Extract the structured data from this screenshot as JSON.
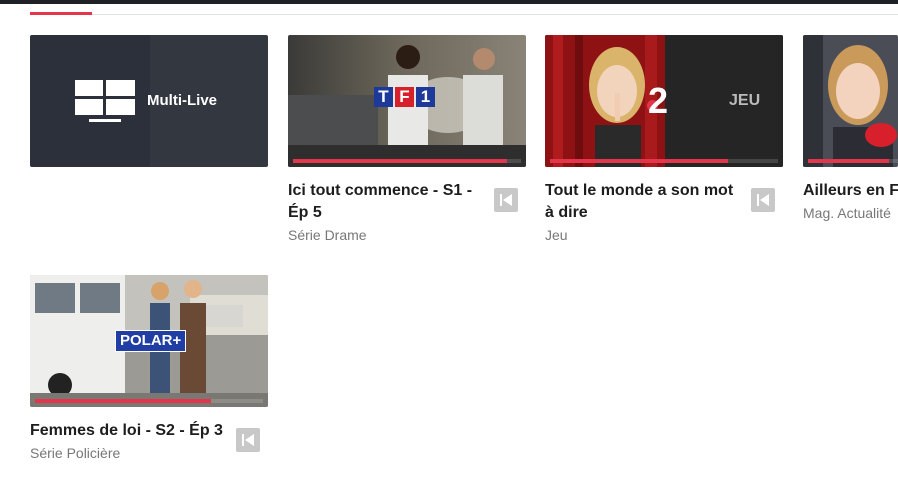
{
  "colors": {
    "accent": "#e3364d",
    "topbar": "#1e2128",
    "tile_dark": "#2c303a",
    "tf1_blue": "#1d3a9a",
    "tf1_red": "#d6202b",
    "polar_blue": "#203ea4"
  },
  "multilive": {
    "label": "Multi-Live",
    "icon": "multi-screen-icon"
  },
  "programs": [
    {
      "title": "Ici tout commence - S1 - Ép 5",
      "subtitle": "Série Drame",
      "channel_logo": [
        "T",
        "F",
        "1"
      ],
      "progress": 0.94,
      "restart_icon": "restart-icon"
    },
    {
      "title": "Tout le monde a son mot à dire",
      "subtitle": "Jeu",
      "channel_logo": "2",
      "overlay_label": "JEU",
      "progress": 0.78,
      "restart_icon": "restart-icon"
    },
    {
      "title": "Ailleurs en F",
      "subtitle": "Mag. Actualité",
      "progress": 0.9
    },
    {
      "title": "Femmes de loi - S2 - Ép 3",
      "subtitle": "Série Policière",
      "channel_logo": "POLAR+",
      "progress": 0.77,
      "restart_icon": "restart-icon"
    }
  ]
}
